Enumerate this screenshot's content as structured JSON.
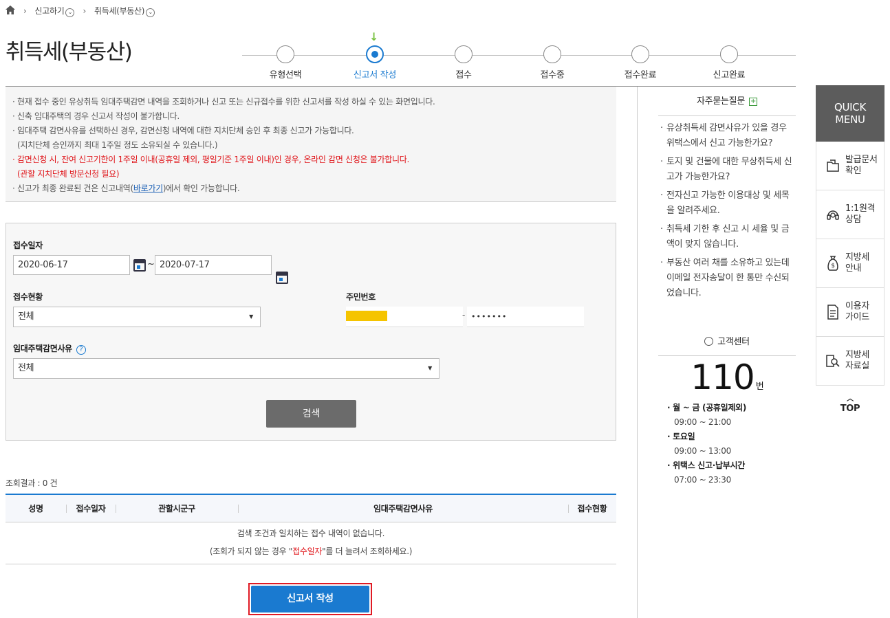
{
  "breadcrumb": {
    "home_icon": "home-icon",
    "item1": "신고하기",
    "item2": "취득세(부동산)"
  },
  "page_title": "취득세(부동산)",
  "steps": [
    {
      "label": "유형선택",
      "active": false
    },
    {
      "label": "신고서 작성",
      "active": true
    },
    {
      "label": "접수",
      "active": false
    },
    {
      "label": "접수중",
      "active": false
    },
    {
      "label": "접수완료",
      "active": false
    },
    {
      "label": "신고완료",
      "active": false
    }
  ],
  "notice": {
    "line1": "· 현재 접수 중인 유상취득 임대주택감면 내역을 조회하거나 신고 또는 신규접수를 위한 신고서를 작성 하실 수 있는 화면입니다.",
    "line2": "· 신축 임대주택의 경우 신고서 작성이 불가합니다.",
    "line3": "· 임대주택 감면사유를 선택하신 경우, 감면신청 내역에 대한 지치단체 승인 후 최종 신고가 가능합니다.",
    "line4": "  (지치단체 승인까지 최대 1주일 정도 소유되실 수 있습니다.)",
    "line5": "· 감면신청 시, 잔여 신고기한이 1주일 이내(공휴일 제외, 평일기준 1주일 이내)인 경우, 온라인 감면 신청은 불가합니다.",
    "line6": "  (관할 지치단체 방문신청 필요)",
    "line7_pre": "· 신고가 최종 완료된 건은 신고내역(",
    "line7_link": "바로가기",
    "line7_post": ")에서 확인 가능합니다."
  },
  "search": {
    "date_label": "접수일자",
    "date_from": "2020-06-17",
    "date_sep": "~",
    "date_to": "2020-07-17",
    "status_label": "접수현황",
    "status_value": "전체",
    "rrn_label": "주민번호",
    "rrn_sep": "-",
    "rrn_back": "•••••••",
    "reason_label": "임대주택감면사유",
    "reason_help": "?",
    "reason_value": "전체",
    "button": "검색"
  },
  "result": {
    "count": "조회결과 : 0 건",
    "columns": [
      "성명",
      "접수일자",
      "관할시군구",
      "임대주택감면사유",
      "접수현황"
    ],
    "empty_line1": "검색 조건과 일치하는 접수 내역이 없습니다.",
    "empty_line2_pre": "(조회가 되지 않는 경우 \"",
    "empty_line2_red": "접수일자",
    "empty_line2_post": "\"를 더 늘려서 조회하세요.)"
  },
  "write_button": "신고서 작성",
  "faq": {
    "title": "자주묻는질문",
    "items": [
      "유상취득세 감면사유가 있을 경우 위택스에서 신고 가능한가요?",
      "토지 및 건물에 대한 무상취득세 신고가 가능한가요?",
      "전자신고 가능한 이용대상 및 세목을 알려주세요.",
      "취득세 기한 후 신고 시 세율 및 금액이 맞지 않습니다.",
      "부동산 여러 채를 소유하고 있는데 이메일 전자송달이 한 통만 수신되었습니다."
    ]
  },
  "customer_center": {
    "title": "고객센터",
    "number": "110",
    "unit": "번",
    "h1": "· 월 ~ 금 (공휴일제외)",
    "t1": "09:00 ~ 21:00",
    "h2": "· 토요일",
    "t2": "09:00 ~ 13:00",
    "h3": "· 위택스 신고·납부시간",
    "t3": "07:00 ~ 23:30"
  },
  "quick_menu": {
    "head1": "QUICK",
    "head2": "MENU",
    "items": [
      {
        "l1": "발급문서",
        "l2": "확인",
        "icon": "document-icon"
      },
      {
        "l1": "1:1원격",
        "l2": "상담",
        "icon": "headset-icon"
      },
      {
        "l1": "지방세",
        "l2": "안내",
        "icon": "money-bag-icon"
      },
      {
        "l1": "이용자",
        "l2": "가이드",
        "icon": "guide-icon"
      },
      {
        "l1": "지방세",
        "l2": "자료실",
        "icon": "archive-search-icon"
      }
    ],
    "top": "TOP"
  },
  "colors": {
    "accent": "#1a7ad0",
    "warning": "#e0161b",
    "highlight": "#f5c400"
  }
}
